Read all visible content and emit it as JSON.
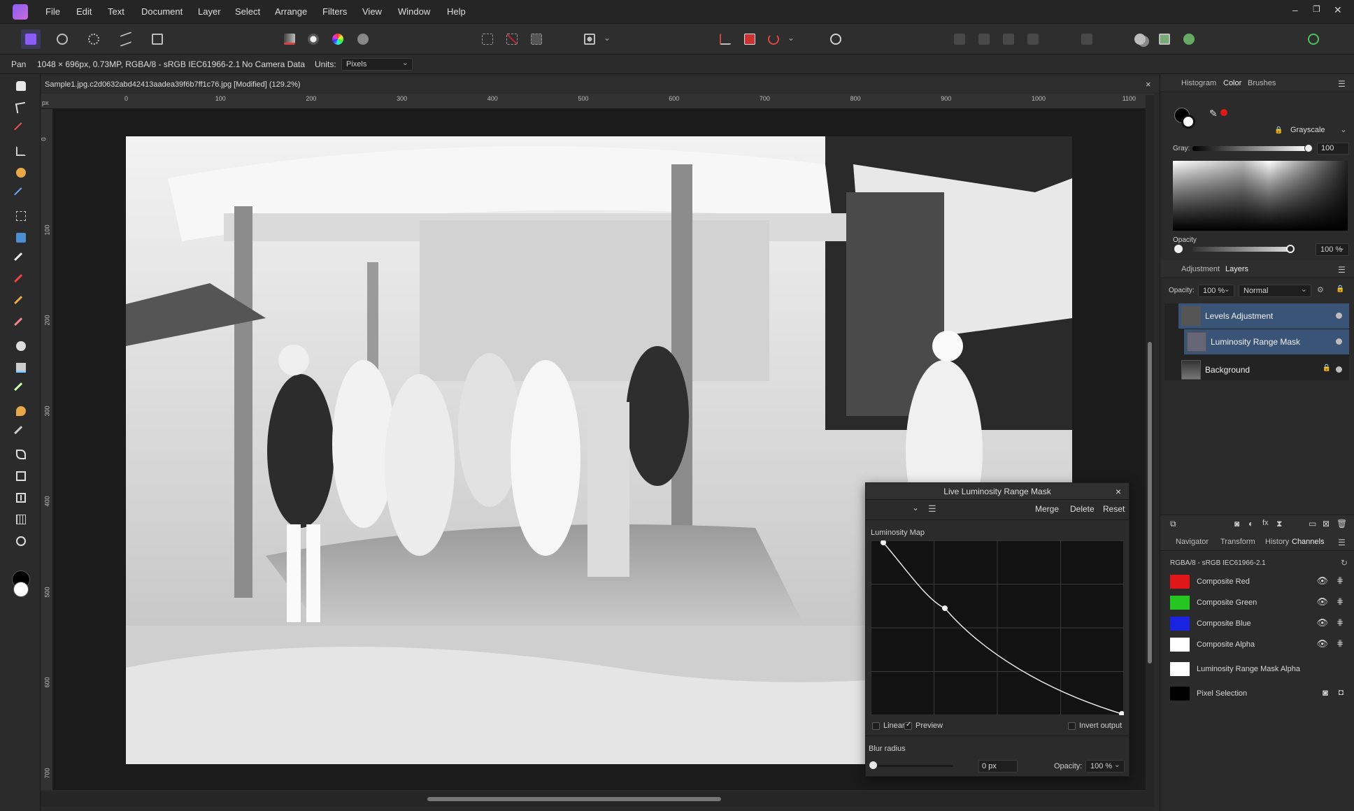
{
  "app": {
    "menu": [
      "File",
      "Edit",
      "Text",
      "Document",
      "Layer",
      "Select",
      "Arrange",
      "Filters",
      "View",
      "Window",
      "Help"
    ],
    "window_controls": [
      "–",
      "❐",
      "✕"
    ]
  },
  "context_bar": {
    "tool": "Pan",
    "image_info": "1048 × 696px, 0.73MP, RGBA/8 - sRGB IEC61966-2.1",
    "camera": "No Camera Data",
    "units_label": "Units:",
    "units_value": "Pixels"
  },
  "document": {
    "tab_title": "Sample1.jpg.c2d0632abd42413aadea39f6b7ff1c76.jpg [Modified] (129.2%)",
    "ruler_unit": "px",
    "h_ticks": [
      "0",
      "100",
      "200",
      "300",
      "400",
      "500",
      "600",
      "700",
      "800",
      "900",
      "1000",
      "1100"
    ],
    "v_ticks": [
      "0",
      "100",
      "200",
      "300",
      "400",
      "500",
      "600",
      "700"
    ]
  },
  "luminosity_dialog": {
    "title": "Live Luminosity Range Mask",
    "merge": "Merge",
    "delete": "Delete",
    "reset": "Reset",
    "map_label": "Luminosity Map",
    "linear_label": "Linear",
    "linear_checked": false,
    "preview_label": "Preview",
    "preview_checked": true,
    "invert_label": "Invert output",
    "invert_checked": false,
    "blur_label": "Blur radius",
    "blur_value": "0 px",
    "opacity_label": "Opacity:",
    "opacity_value": "100 %"
  },
  "color_panel": {
    "tabs": [
      "Histogram",
      "Color",
      "Brushes"
    ],
    "active_tab": "Color",
    "mode": "Grayscale",
    "gray_label": "Gray:",
    "gray_value": "100",
    "opacity_label": "Opacity",
    "opacity_value": "100 %"
  },
  "layers_panel": {
    "tabs": [
      "Adjustment",
      "Layers"
    ],
    "active_tab": "Layers",
    "opacity_label": "Opacity:",
    "opacity_value": "100 %",
    "blend_mode": "Normal",
    "layers": [
      {
        "name": "Levels Adjustment",
        "selected": true
      },
      {
        "name": "Luminosity Range Mask",
        "selected": true
      },
      {
        "name": "Background",
        "selected": false
      }
    ]
  },
  "channels_panel": {
    "tabs": [
      "Navigator",
      "Transform",
      "History",
      "Channels"
    ],
    "active_tab": "Channels",
    "profile": "RGBA/8 - sRGB IEC61966-2.1",
    "channels": [
      {
        "name": "Composite Red",
        "color": "#e0161b"
      },
      {
        "name": "Composite Green",
        "color": "#25c61f"
      },
      {
        "name": "Composite Blue",
        "color": "#1a24e0"
      },
      {
        "name": "Composite Alpha",
        "color": "#ffffff"
      },
      {
        "name": "Luminosity Range Mask Alpha",
        "color": "#ffffff"
      },
      {
        "name": "Pixel Selection",
        "color": "#000000"
      }
    ]
  },
  "colors": {
    "accent": "#3d5a8a",
    "selected_layer": "#3a5478",
    "logo": "#8a5cf5"
  }
}
